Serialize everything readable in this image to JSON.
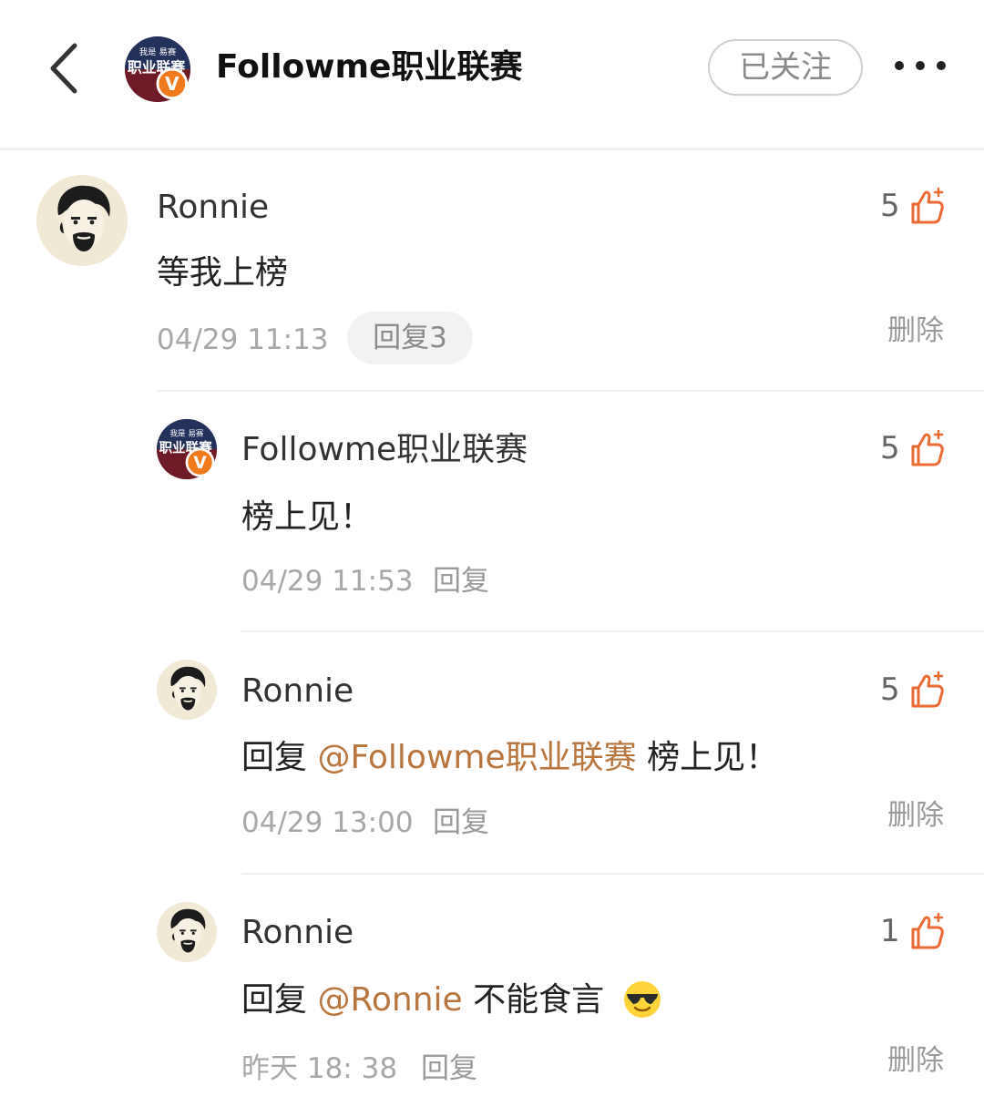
{
  "header": {
    "account_name": "Followme职业联赛",
    "follow_label": "已关注",
    "avatar_text_top": "我是 易赛",
    "avatar_text_main": "职业联赛",
    "verified_badge": "V"
  },
  "colors": {
    "accent": "#b8753d",
    "like_icon": "#ec6a33",
    "verified_badge": "#f07a1c"
  },
  "comments": [
    {
      "user": "Ronnie",
      "text": "等我上榜",
      "time": "04/29 11:13",
      "replies_label": "回复3",
      "likes": "5",
      "delete_label": "删除"
    },
    {
      "user": "Followme职业联赛",
      "text": "榜上见！",
      "time": "04/29 11:53",
      "reply_label": "回复",
      "likes": "5"
    },
    {
      "user": "Ronnie",
      "reply_prefix": "回复",
      "mention": "@Followme职业联赛",
      "text": "榜上见！",
      "time": "04/29 13:00",
      "reply_label": "回复",
      "likes": "5",
      "delete_label": "删除"
    },
    {
      "user": "Ronnie",
      "reply_prefix": "回复",
      "mention": "@Ronnie",
      "text": "不能食言",
      "emoji": "sunglasses-emoji",
      "time": "昨天 18: 38",
      "reply_label": "回复",
      "likes": "1",
      "delete_label": "删除"
    }
  ]
}
